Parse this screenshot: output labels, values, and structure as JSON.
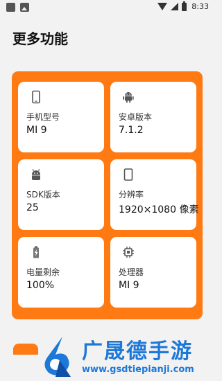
{
  "status_bar": {
    "time": "8:33"
  },
  "page": {
    "title": "更多功能"
  },
  "colors": {
    "accent": "#ff7a12",
    "card_bg": "#ffffff",
    "page_bg": "#f2f2f2",
    "icon": "#555555",
    "watermark": "#1d78d8"
  },
  "cards": [
    {
      "icon": "phone-icon",
      "label": "手机型号",
      "value": "MI 9"
    },
    {
      "icon": "android-icon",
      "label": "安卓版本",
      "value": "7.1.2"
    },
    {
      "icon": "android-head-icon",
      "label": "SDK版本",
      "value": "25"
    },
    {
      "icon": "screen-icon",
      "label": "分辨率",
      "value": "1920×1080 像素"
    },
    {
      "icon": "battery-icon",
      "label": "电量剩余",
      "value": "100%"
    },
    {
      "icon": "chip-icon",
      "label": "处理器",
      "value": "MI 9"
    }
  ],
  "watermark": {
    "title": "广晟德手游",
    "url": "www.gsdtiepianji.com"
  }
}
